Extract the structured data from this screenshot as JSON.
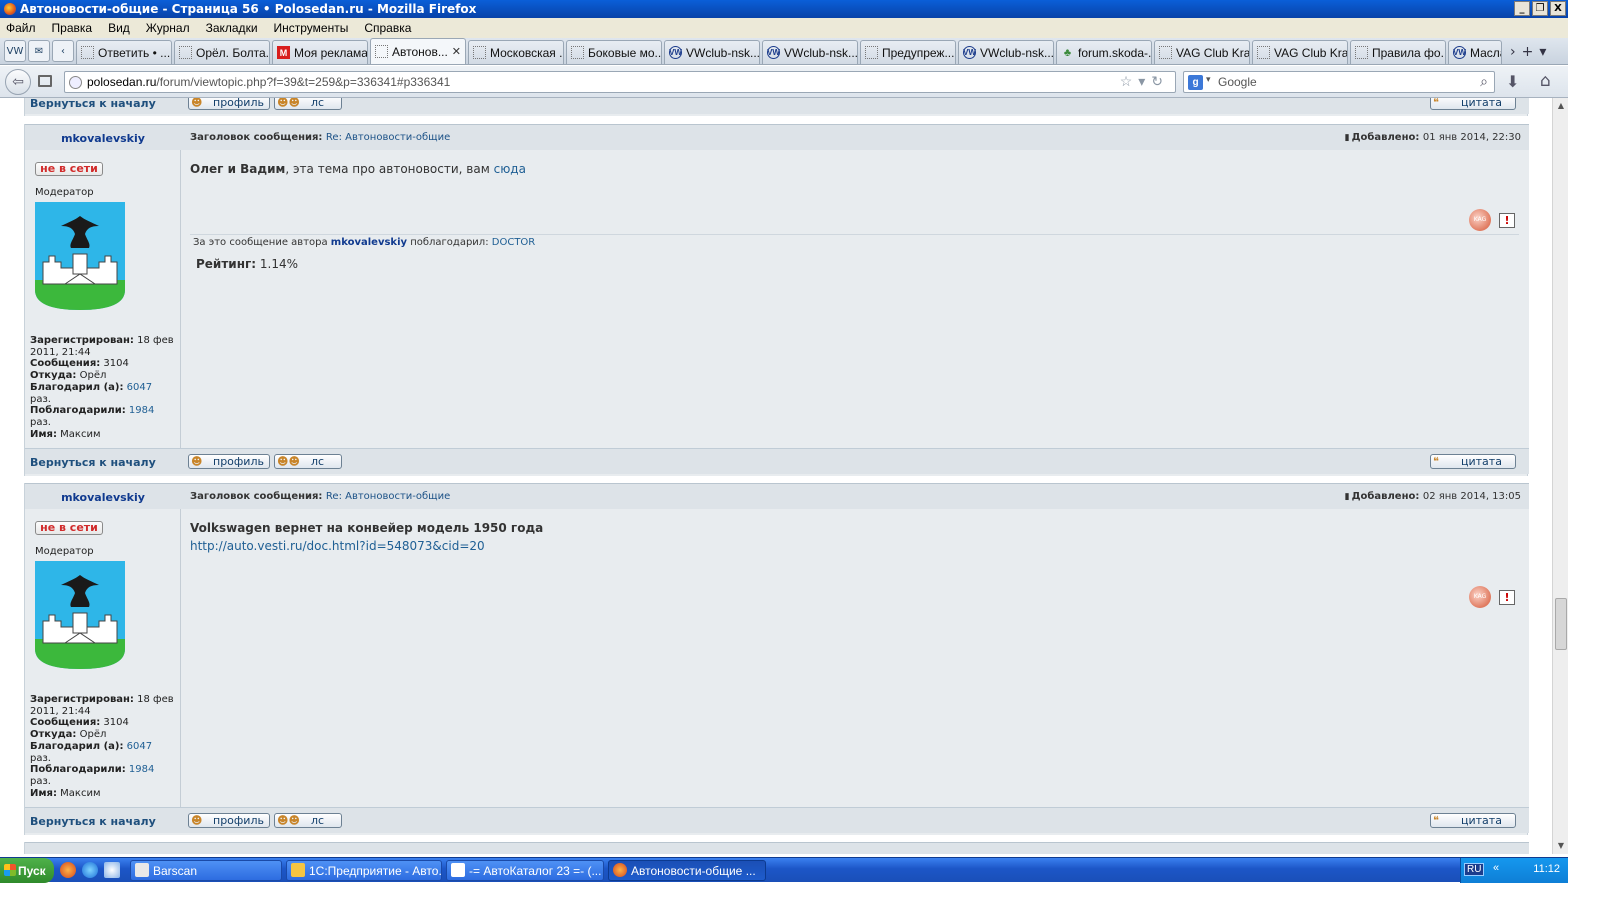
{
  "window": {
    "title": "Автоновости-общие - Страница 56 • Polosedan.ru - Mozilla Firefox",
    "buttons": [
      "_",
      "❐",
      "X"
    ]
  },
  "menu": [
    "Файл",
    "Правка",
    "Вид",
    "Журнал",
    "Закладки",
    "Инструменты",
    "Справка"
  ],
  "tabs": [
    {
      "label": "Ответить • ...",
      "fav": ""
    },
    {
      "label": "Орёл. Болта...",
      "fav": ""
    },
    {
      "label": "Моя реклама",
      "fav": "M"
    },
    {
      "label": "Автонов...",
      "fav": "",
      "active": true
    },
    {
      "label": "Московская ...",
      "fav": ""
    },
    {
      "label": "Боковые мо...",
      "fav": ""
    },
    {
      "label": "VWclub-nsk....",
      "fav": "VW"
    },
    {
      "label": "VWclub-nsk....",
      "fav": "VW"
    },
    {
      "label": "Предупреж...",
      "fav": ""
    },
    {
      "label": "VWclub-nsk....",
      "fav": "VW"
    },
    {
      "label": "forum.skoda-...",
      "fav": "SK"
    },
    {
      "label": "VAG Club Kra...",
      "fav": ""
    },
    {
      "label": "VAG Club Kra...",
      "fav": ""
    },
    {
      "label": "Правила фо...",
      "fav": ""
    },
    {
      "label": "Масла",
      "fav": "VW"
    }
  ],
  "nav": {
    "url_domain": "polosedan.ru",
    "url_path": "/forum/viewtopic.php?f=39&t=259&p=336341#p336341",
    "search_placeholder": "Google",
    "search_engine": "g"
  },
  "forum": {
    "back_to_top": "Вернуться к началу",
    "btn_profile": "профиль",
    "btn_pm": "лс",
    "btn_quote": "цитата",
    "subject_label": "Заголовок сообщения:",
    "added_label": "Добавлено:",
    "posts": [
      {
        "author": "mkovalevskiy",
        "status": "не в сети",
        "role": "Модератор",
        "subject": "Re: Автоновости-общие",
        "added": "01 янв 2014, 22:30",
        "message_bold": "Олег и Вадим",
        "message_text": ", эта тема про автоновости, вам ",
        "message_link": "сюда",
        "thanks_prefix": "За это сообщение автора",
        "thanks_author": "mkovalevskiy",
        "thanks_mid": "поблагодарил:",
        "thanks_user": "DOCTOR",
        "rating_label": "Рейтинг:",
        "rating_value": "1.14%",
        "stats": {
          "registered_label": "Зарегистрирован:",
          "registered": "18 фев 2011, 21:44",
          "messages_label": "Сообщения:",
          "messages": "3104",
          "from_label": "Откуда:",
          "from": "Орёл",
          "thanked_label": "Благодарил (а):",
          "thanked": "6047",
          "times": "раз.",
          "was_thanked_label": "Поблагодарили:",
          "was_thanked": "1984",
          "name_label": "Имя:",
          "name": "Максим"
        }
      },
      {
        "author": "mkovalevskiy",
        "status": "не в сети",
        "role": "Модератор",
        "subject": "Re: Автоновости-общие",
        "added": "02 янв 2014, 13:05",
        "message_bold": "Volkswagen вернет на конвейер модель 1950 года",
        "message_link": "http://auto.vesti.ru/doc.html?id=548073&cid=20",
        "stats": {
          "registered_label": "Зарегистрирован:",
          "registered": "18 фев 2011, 21:44",
          "messages_label": "Сообщения:",
          "messages": "3104",
          "from_label": "Откуда:",
          "from": "Орёл",
          "thanked_label": "Благодарил (а):",
          "thanked": "6047",
          "times": "раз.",
          "was_thanked_label": "Поблагодарили:",
          "was_thanked": "1984",
          "name_label": "Имя:",
          "name": "Максим"
        }
      }
    ]
  },
  "taskbar": {
    "start": "Пуск",
    "tasks": [
      {
        "label": "Barscan"
      },
      {
        "label": "1С:Предприятие - Авто..."
      },
      {
        "label": "-= АвтоКаталог 23 =- (..."
      },
      {
        "label": "Автоновости-общие ...",
        "active": true
      }
    ],
    "lang": "RU",
    "clock": "11:12"
  }
}
